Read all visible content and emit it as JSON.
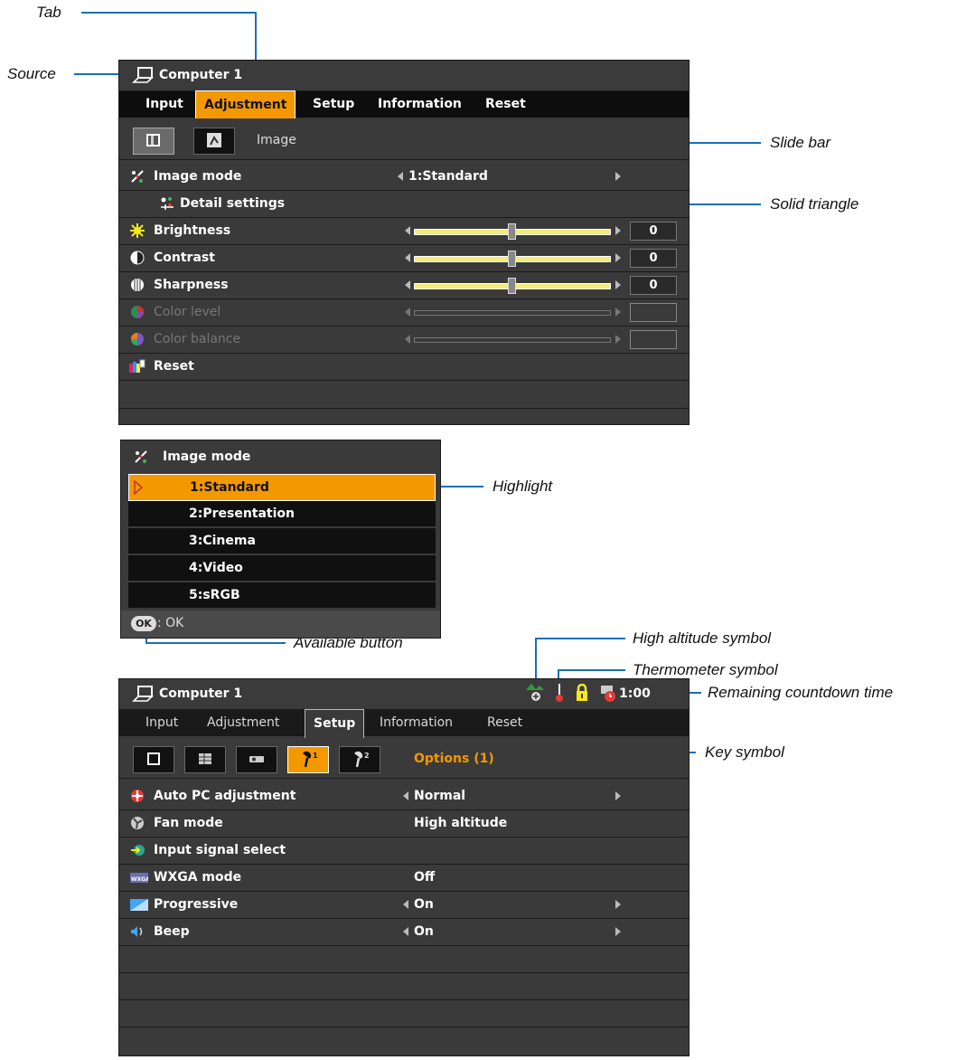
{
  "callouts": {
    "tab": "Tab",
    "source": "Source",
    "slide_bar": "Slide bar",
    "solid_triangle": "Solid triangle",
    "highlight": "Highlight",
    "available_button": "Available button",
    "high_altitude": "High altitude symbol",
    "thermometer": "Thermometer symbol",
    "remaining_time": "Remaining countdown time",
    "key_symbol": "Key symbol"
  },
  "menu1": {
    "source": "Computer 1",
    "tabs": [
      "Input",
      "Adjustment",
      "Setup",
      "Information",
      "Reset"
    ],
    "subtab_label": "Image",
    "rows": {
      "image_mode": {
        "label": "Image mode",
        "value": "1:Standard"
      },
      "detail_settings": {
        "label": "Detail settings"
      },
      "brightness": {
        "label": "Brightness",
        "value": "0",
        "level": 0.5
      },
      "contrast": {
        "label": "Contrast",
        "value": "0",
        "level": 0.5
      },
      "sharpness": {
        "label": "Sharpness",
        "value": "0",
        "level": 0.5
      },
      "color_level": {
        "label": "Color level"
      },
      "color_balance": {
        "label": "Color balance"
      },
      "reset": {
        "label": "Reset"
      }
    }
  },
  "menu2": {
    "title": "Image mode",
    "options": [
      "1:Standard",
      "2:Presentation",
      "3:Cinema",
      "4:Video",
      "5:sRGB"
    ],
    "selected_index": 0,
    "ok_badge": "OK",
    "ok_text": ": OK"
  },
  "menu3": {
    "source": "Computer 1",
    "timer": "1:00",
    "tabs": [
      "Input",
      "Adjustment",
      "Setup",
      "Information",
      "Reset"
    ],
    "subtab_label": "Options (1)",
    "rows": [
      {
        "label": "Auto PC adjustment",
        "value": "Normal",
        "arrows": true
      },
      {
        "label": "Fan mode",
        "value": "High altitude",
        "arrows": false
      },
      {
        "label": "Input signal select",
        "value": "",
        "arrows": false
      },
      {
        "label": "WXGA mode",
        "value": "Off",
        "arrows": false
      },
      {
        "label": "Progressive",
        "value": "On",
        "arrows": true
      },
      {
        "label": "Beep",
        "value": "On",
        "arrows": true
      }
    ]
  },
  "colors": {
    "accent": "#f39800",
    "callout_line": "#1a6fb5"
  }
}
